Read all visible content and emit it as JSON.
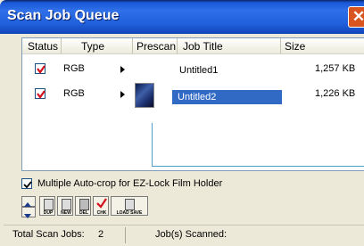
{
  "window": {
    "title": "Scan Job Queue",
    "close_glyph": "✕"
  },
  "columns": [
    "Status",
    "Type",
    "Prescan",
    "Job Title",
    "Size"
  ],
  "rows": [
    {
      "status_checked": true,
      "type": "RGB",
      "has_prescan": false,
      "title": "Untitled1",
      "size": "1,257 KB",
      "selected": false
    },
    {
      "status_checked": true,
      "type": "RGB",
      "has_prescan": true,
      "title": "Untitled2",
      "size": "1,226 KB",
      "selected": true
    }
  ],
  "option": {
    "label": "Multiple Auto-crop for EZ-Lock Film Holder",
    "checked": true
  },
  "toolbar": {
    "buttons": [
      "DUP",
      "NEW",
      "DEL",
      "CHK",
      "LOAD SAVE"
    ]
  },
  "status": {
    "total_label": "Total Scan Jobs:",
    "total_value": "2",
    "scanned_label": "Job(s) Scanned:"
  },
  "colors": {
    "accent": "#316ac5",
    "check": "#d4101b",
    "title_bar": "#2160dc"
  }
}
